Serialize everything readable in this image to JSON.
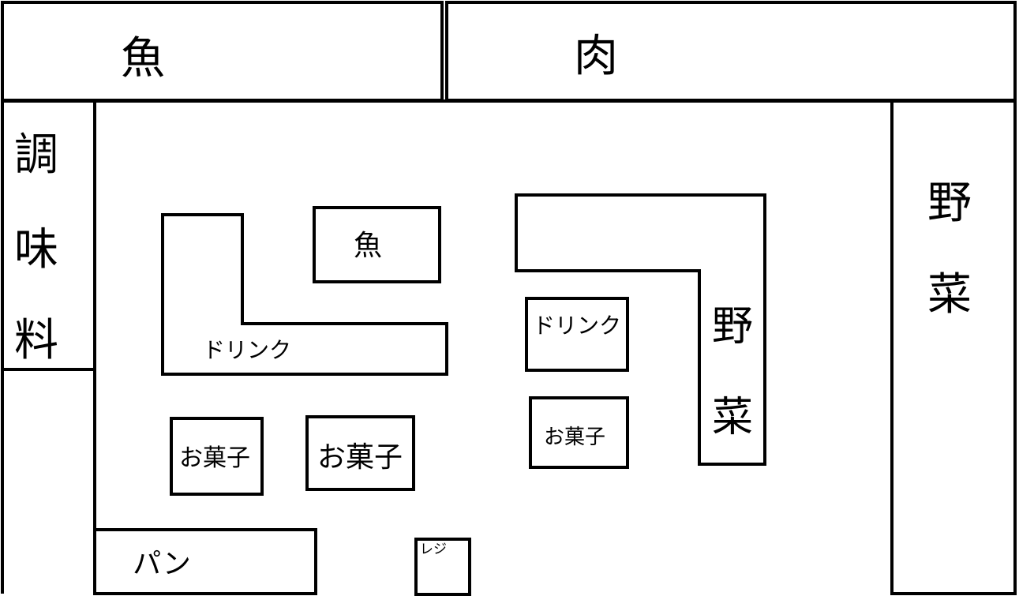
{
  "colors": {
    "stroke": "#000000",
    "background": "#ffffff"
  },
  "sections": {
    "fish_top": "魚",
    "meat_top": "肉",
    "seasoning": [
      "調",
      "味",
      "料"
    ],
    "vegetables_right": [
      "野",
      "菜"
    ],
    "bread": "パン"
  },
  "shelves": {
    "fish_center": "魚",
    "drink_l_shelf": "ドリンク",
    "drink_box": "ドリンク",
    "vegetables_l_shelf": [
      "野",
      "菜"
    ],
    "snacks_1": "お菓子",
    "snacks_2": "お菓子",
    "snacks_3": "お菓子",
    "register": "レジ"
  }
}
